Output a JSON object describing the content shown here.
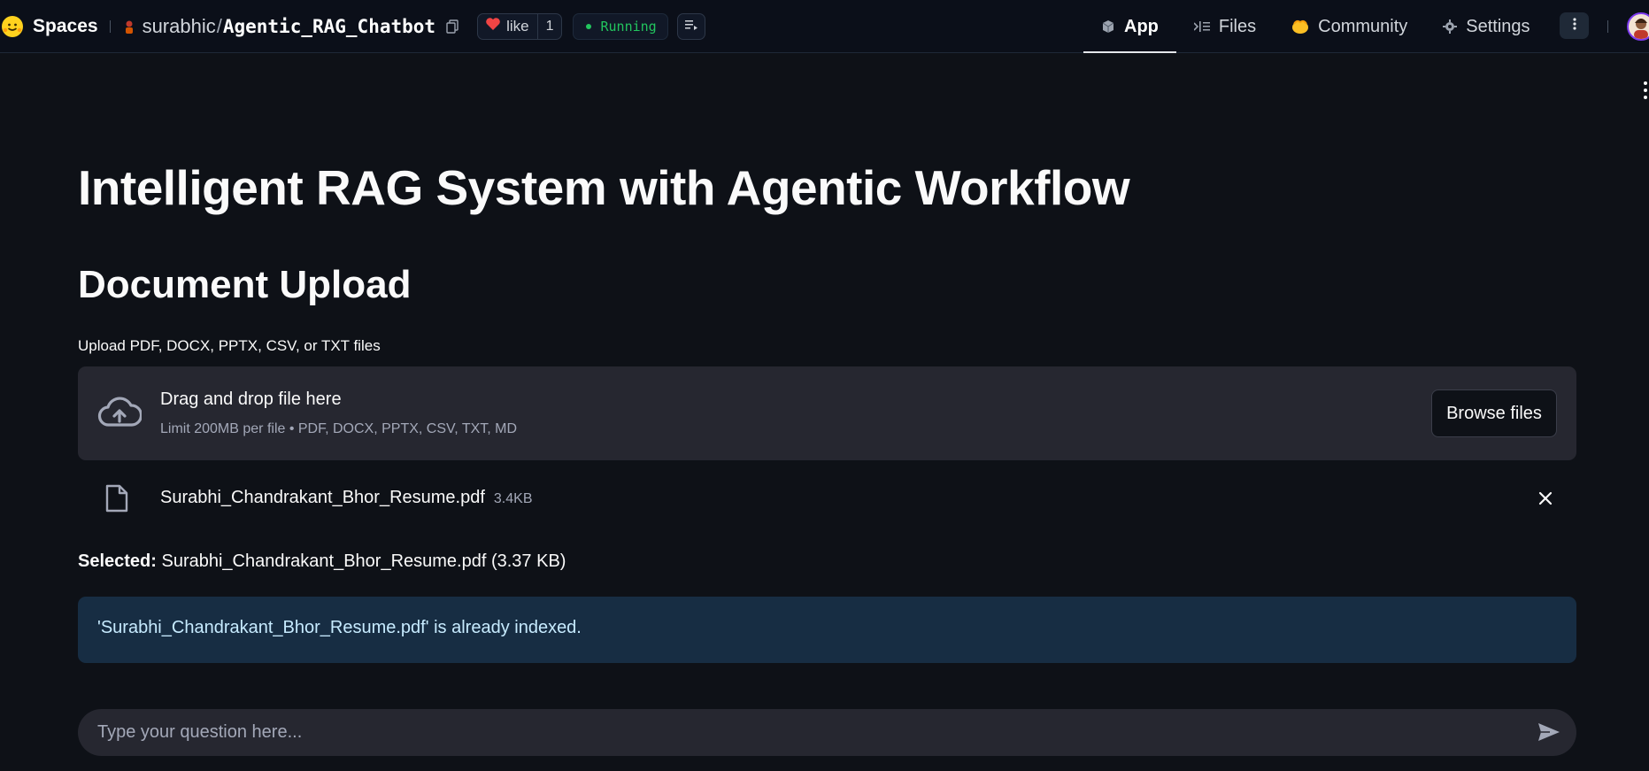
{
  "topbar": {
    "brand": "Spaces",
    "owner": "surabhic",
    "separator": "/",
    "repo": "Agentic_RAG_Chatbot",
    "like_label": "like",
    "like_count": "1",
    "status": "Running",
    "status_color": "#22c55e"
  },
  "tabs": [
    {
      "label": "App",
      "icon": "cube-icon",
      "active": true
    },
    {
      "label": "Files",
      "icon": "files-icon",
      "active": false
    },
    {
      "label": "Community",
      "icon": "community-icon",
      "active": false
    },
    {
      "label": "Settings",
      "icon": "gear-icon",
      "active": false
    }
  ],
  "main": {
    "title": "Intelligent RAG System with Agentic Workflow",
    "section_title": "Document Upload",
    "upload_label": "Upload PDF, DOCX, PPTX, CSV, or TXT files",
    "dropzone": {
      "title": "Drag and drop file here",
      "subtitle": "Limit 200MB per file • PDF, DOCX, PPTX, CSV, TXT, MD",
      "browse_label": "Browse files"
    },
    "uploaded_file": {
      "name": "Surabhi_Chandrakant_Bhor_Resume.pdf",
      "size": "3.4KB"
    },
    "selected": {
      "label": "Selected:",
      "value": "Surabhi_Chandrakant_Bhor_Resume.pdf (3.37 KB)"
    },
    "info_message": "'Surabhi_Chandrakant_Bhor_Resume.pdf' is already indexed.",
    "chat_placeholder": "Type your question here..."
  },
  "colors": {
    "background": "#0e1117",
    "panel": "#262730",
    "info_bg": "#172d43",
    "info_text": "#c7ebff"
  }
}
